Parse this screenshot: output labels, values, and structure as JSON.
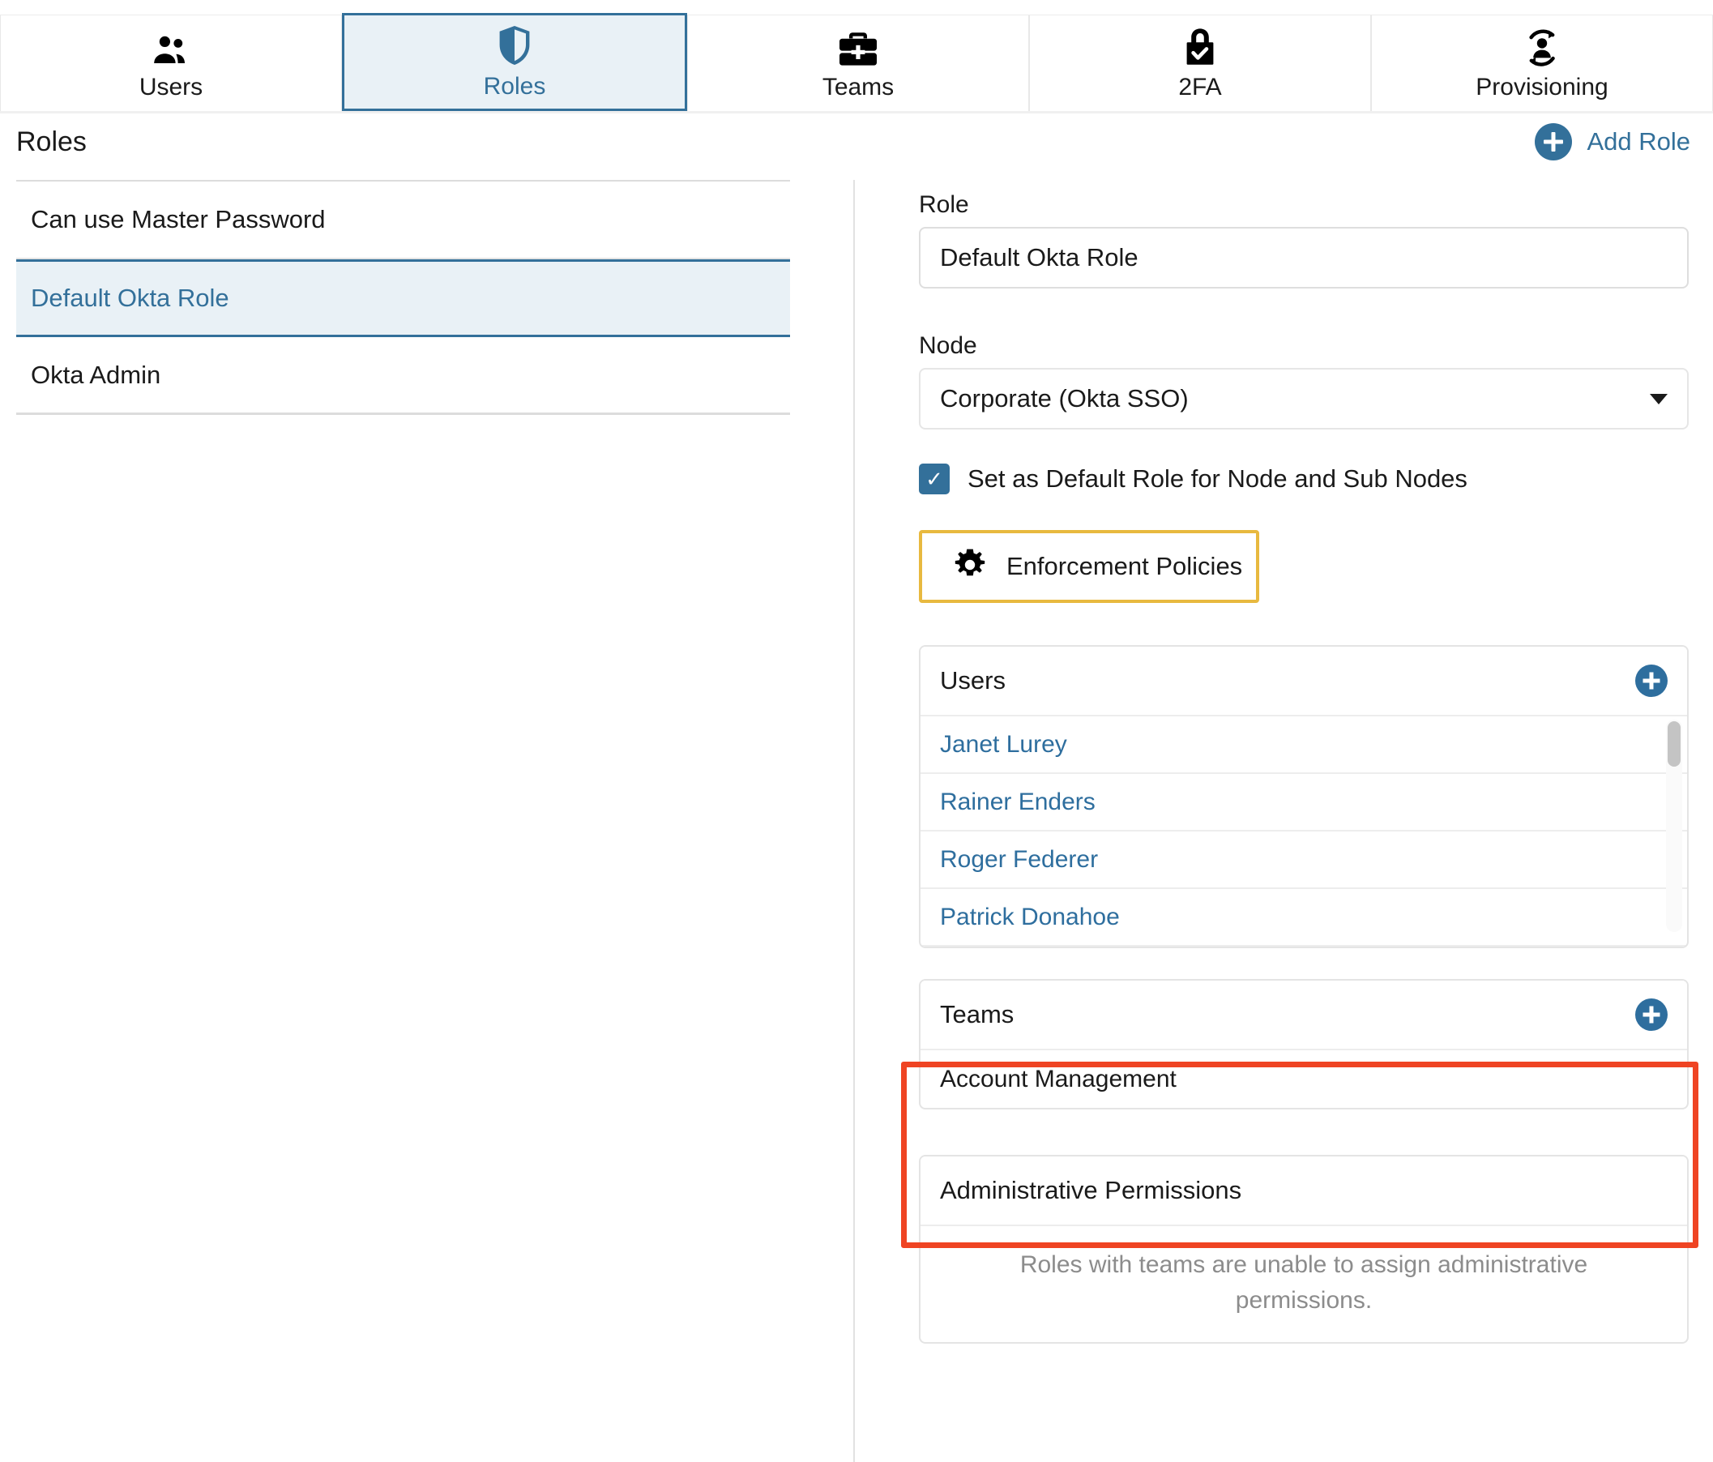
{
  "tabs": [
    {
      "label": "Users",
      "icon": "users-icon",
      "active": false
    },
    {
      "label": "Roles",
      "icon": "shield-icon",
      "active": true
    },
    {
      "label": "Teams",
      "icon": "briefcase-icon",
      "active": false
    },
    {
      "label": "2FA",
      "icon": "lock-check-icon",
      "active": false
    },
    {
      "label": "Provisioning",
      "icon": "user-sync-icon",
      "active": false
    }
  ],
  "header": {
    "title": "Roles",
    "add_role_label": "Add Role",
    "add_role_icon": "plus-circle-icon"
  },
  "role_list": [
    {
      "label": "Can use Master Password",
      "selected": false
    },
    {
      "label": "Default Okta Role",
      "selected": true
    },
    {
      "label": "Okta Admin",
      "selected": false
    }
  ],
  "form": {
    "role_label": "Role",
    "role_value": "Default Okta Role",
    "role_placeholder": "Role",
    "node_label": "Node",
    "node_value": "Corporate (Okta SSO)",
    "node_options": [
      "Corporate (Okta SSO)"
    ],
    "default_role_checkbox_label": "Set as Default Role for Node and Sub Nodes",
    "default_role_checked": true,
    "checkbox_glyph": "✓",
    "enforcement_button_label": "Enforcement Policies",
    "enforcement_button_icon": "gear-icon"
  },
  "users_panel": {
    "title": "Users",
    "add_icon": "plus-circle-icon",
    "items": [
      "Janet Lurey",
      "Rainer Enders",
      "Roger Federer",
      "Patrick Donahoe"
    ]
  },
  "teams_panel": {
    "title": "Teams",
    "add_icon": "plus-circle-icon",
    "items": [
      "Account Management"
    ]
  },
  "admin_panel": {
    "title": "Administrative Permissions",
    "note": "Roles with teams are unable to assign administrative permissions."
  },
  "colors": {
    "accent": "#33709a",
    "link": "#2e6e9e",
    "selected_bg": "#e9f1f6",
    "enforcement_border": "#e8b93f",
    "annotation": "#ef4423",
    "muted_text": "#8c8c8c"
  }
}
